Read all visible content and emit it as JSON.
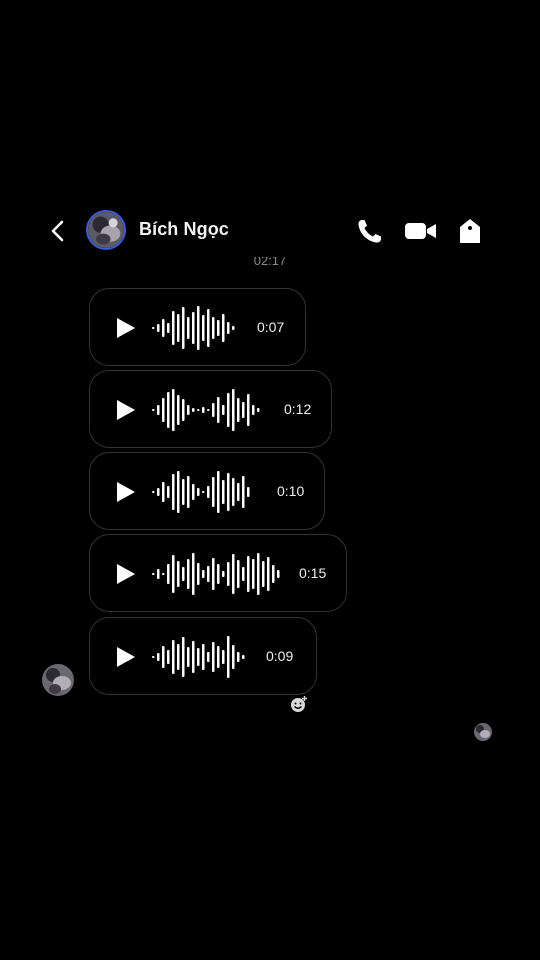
{
  "header": {
    "back_icon": "chevron-left-icon",
    "contact_name": "Bích Ngọc",
    "actions": [
      "phone-icon",
      "video-camera-icon",
      "shield-icon"
    ]
  },
  "conversation": {
    "timestamp": "02:17",
    "voice_messages": [
      {
        "duration": "0:07"
      },
      {
        "duration": "0:12"
      },
      {
        "duration": "0:10"
      },
      {
        "duration": "0:15"
      },
      {
        "duration": "0:09"
      }
    ],
    "reaction_icon": "add-reaction-icon"
  },
  "colors": {
    "background": "#000000",
    "text": "#ffffff",
    "avatar_ring": "#3b5bdb",
    "bubble_border": "#333333",
    "muted_text": "#8a8a8a"
  }
}
